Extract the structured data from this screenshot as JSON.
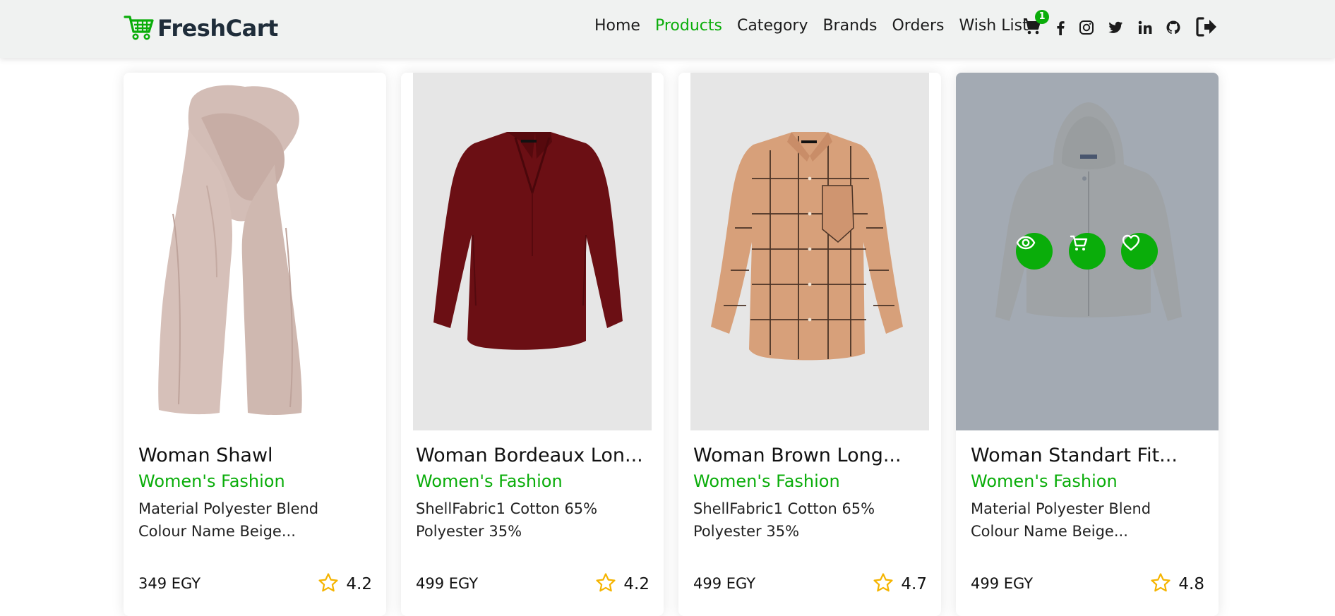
{
  "brand": {
    "name": "FreshCart",
    "icon": "cart-logo-icon",
    "color": "#0aad0a"
  },
  "nav": {
    "links": [
      {
        "label": "Home",
        "active": false
      },
      {
        "label": "Products",
        "active": true
      },
      {
        "label": "Category",
        "active": false
      },
      {
        "label": "Brands",
        "active": false
      },
      {
        "label": "Orders",
        "active": false
      },
      {
        "label": "Wish List",
        "active": false
      }
    ],
    "cart_count": "1",
    "social": [
      "facebook-icon",
      "instagram-icon",
      "twitter-icon",
      "linkedin-icon",
      "github-icon"
    ],
    "logout_icon": "sign-out-icon"
  },
  "accent_color": "#0aad0a",
  "products": [
    {
      "title": "Woman Shawl",
      "category": "Women's Fashion",
      "desc_line1": "Material Polyester Blend",
      "desc_line2": "Colour Name Beige...",
      "price": "349 EGY",
      "rating": "4.2",
      "hovered": false
    },
    {
      "title": "Woman Bordeaux Lon...",
      "category": "Women's Fashion",
      "desc_line1": "ShellFabric1 Cotton 65%",
      "desc_line2": "Polyester 35%",
      "price": "499 EGY",
      "rating": "4.2",
      "hovered": false
    },
    {
      "title": "Woman Brown Long...",
      "category": "Women's Fashion",
      "desc_line1": "ShellFabric1 Cotton 65%",
      "desc_line2": "Polyester 35%",
      "price": "499 EGY",
      "rating": "4.7",
      "hovered": false
    },
    {
      "title": "Woman Standart Fit...",
      "category": "Women's Fashion",
      "desc_line1": "Material Polyester Blend",
      "desc_line2": "Colour Name Beige...",
      "price": "499 EGY",
      "rating": "4.8",
      "hovered": true,
      "actions": [
        "eye-icon",
        "cart-icon",
        "heart-icon"
      ]
    }
  ]
}
